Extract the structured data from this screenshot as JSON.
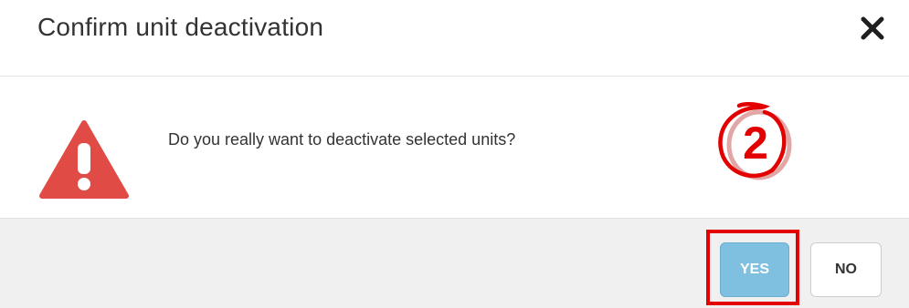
{
  "dialog": {
    "title": "Confirm unit deactivation",
    "close_icon": "close-icon",
    "warning_icon": "warning-triangle-icon",
    "message": "Do you really want to deactivate selected units?",
    "annotation_number": "2",
    "buttons": {
      "yes_label": "YES",
      "no_label": "NO"
    }
  },
  "colors": {
    "warning": "#e04b45",
    "yes_button": "#7fbfe0",
    "highlight": "#e30000",
    "footer_bg": "#f0f0f0"
  }
}
